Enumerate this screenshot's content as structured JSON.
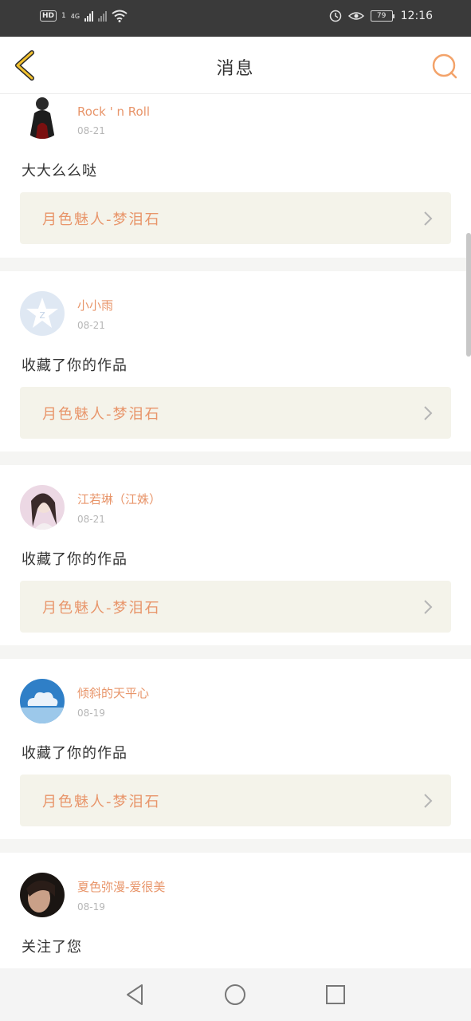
{
  "status_bar": {
    "hd": "HD",
    "sim": "1",
    "network": "4G",
    "battery": "79",
    "time": "12:16"
  },
  "header": {
    "title": "消息"
  },
  "messages": [
    {
      "user": "Rock ' n Roll",
      "date": "08-21",
      "text": "大大么么哒",
      "work": "月色魅人-梦泪石"
    },
    {
      "user": "小小雨",
      "date": "08-21",
      "text": "收藏了你的作品",
      "work": "月色魅人-梦泪石"
    },
    {
      "user": "江若琳（江姝）",
      "date": "08-21",
      "text": "收藏了你的作品",
      "work": "月色魅人-梦泪石"
    },
    {
      "user": "倾斜的天平心",
      "date": "08-19",
      "text": "收藏了你的作品",
      "work": "月色魅人-梦泪石"
    },
    {
      "user": "夏色弥漫-爱很美",
      "date": "08-19",
      "text": "关注了您"
    }
  ],
  "colors": {
    "accent": "#e8956a",
    "work_bg": "#f4f3ea",
    "status_bar": "#3a3a3a",
    "back_arrow": "#f2c12e"
  }
}
